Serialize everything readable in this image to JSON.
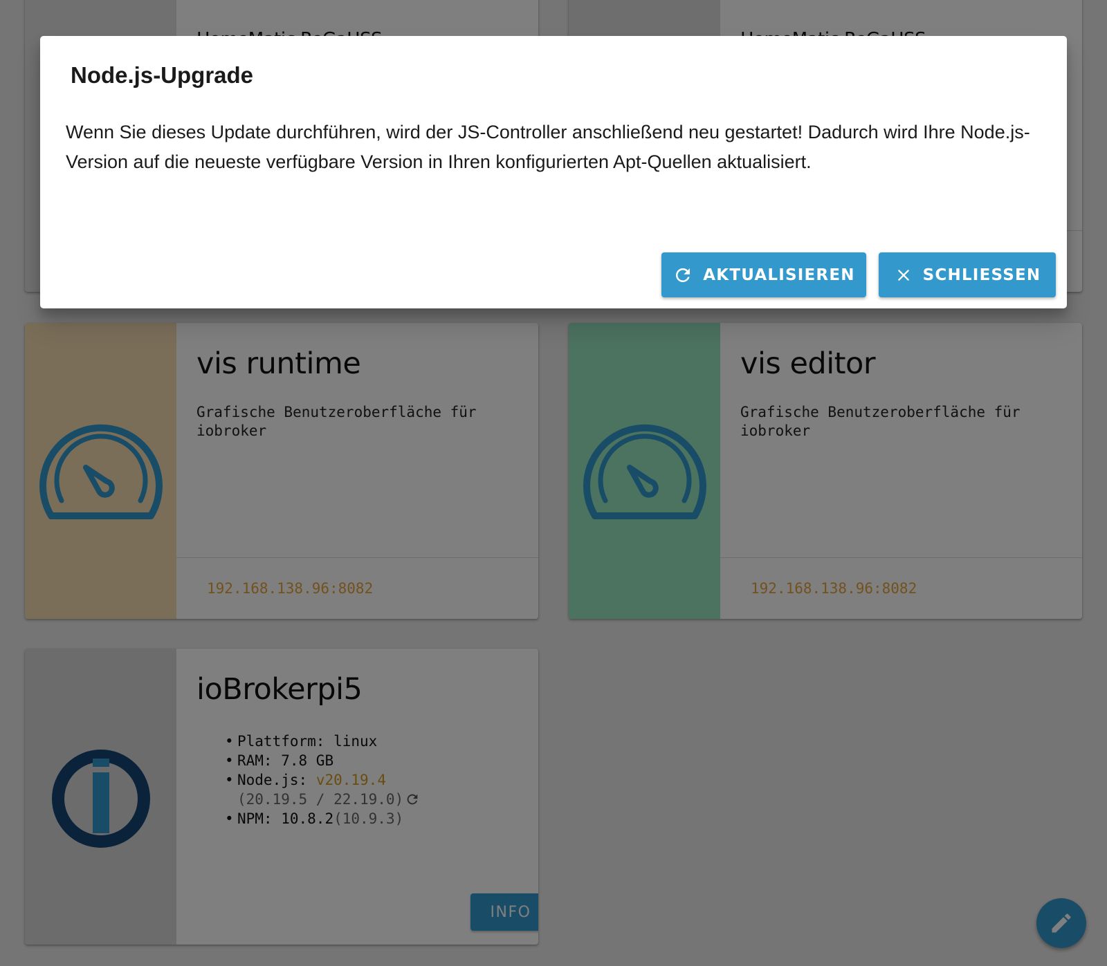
{
  "background_cards": [
    {
      "title": "HomeMatic ReGaHSS"
    },
    {
      "title": "HomeMatic ReGaHSS"
    }
  ],
  "cards": [
    {
      "title": "vis runtime",
      "description": "Grafische Benutzeroberfläche für iobroker",
      "link": "192.168.138.96:8082",
      "side_color": "#f6dcb2",
      "icon": "speedometer-icon"
    },
    {
      "title": "vis editor",
      "description": "Grafische Benutzeroberfläche für iobroker",
      "link": "192.168.138.96:8082",
      "side_color": "#99e5c0",
      "icon": "speedometer-icon"
    }
  ],
  "host": {
    "title": "ioBrokerpi5",
    "icon": "iobroker-logo-icon",
    "platform_label": "Plattform:",
    "platform_value": "linux",
    "ram_label": "RAM:",
    "ram_value": "7.8 GB",
    "node_label": "Node.js:",
    "node_value": "v20.19.4",
    "node_available": "(20.19.5 / 22.19.0)",
    "npm_label": "NPM:",
    "npm_value": "10.8.2",
    "npm_available": "(10.9.3)",
    "info_label": "INFO"
  },
  "fab": {
    "icon": "pencil-icon"
  },
  "dialog": {
    "title": "Node.js-Upgrade",
    "body": "Wenn Sie dieses Update durchführen, wird der JS-Controller anschließend neu gestartet! Dadurch wird Ihre Node.js-Version auf die neueste verfügbare Version in Ihren konfigurierten Apt-Quellen aktualisiert.",
    "update_label": "AKTUALISIEREN",
    "close_label": "SCHLIESSEN",
    "update_icon": "refresh-icon",
    "close_icon": "close-icon"
  },
  "colors": {
    "primary": "#3399cc",
    "link": "#e6a33a",
    "version": "#d49a1c"
  }
}
